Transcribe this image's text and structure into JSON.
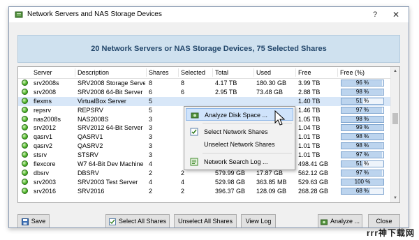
{
  "window": {
    "title": "Network Servers and NAS Storage Devices",
    "help": "?",
    "close": "✕"
  },
  "banner": {
    "text": "20 Network Servers or NAS Storage Devices, 75 Selected Shares"
  },
  "table": {
    "columns": [
      "Server",
      "Description",
      "Shares",
      "Selected",
      "Total",
      "Used",
      "Free",
      "Free (%)"
    ],
    "rows": [
      {
        "server": "srv2008s",
        "description": "SRV2008 Storage Server",
        "shares": "8",
        "selected": "8",
        "total": "4.17 TB",
        "used": "180.30 GB",
        "free": "3.99 TB",
        "free_pct": "96 %",
        "pct": 96
      },
      {
        "server": "srv2008",
        "description": "SRV2008 64-Bit Server",
        "shares": "6",
        "selected": "6",
        "total": "2.95 TB",
        "used": "73.48 GB",
        "free": "2.88 TB",
        "free_pct": "98 %",
        "pct": 98
      },
      {
        "server": "flexms",
        "description": "VirtualBox Server",
        "shares": "5",
        "selected": "",
        "total": "",
        "used": "",
        "free": "1.40 TB",
        "free_pct": "51 %",
        "pct": 51
      },
      {
        "server": "repsrv",
        "description": "REPSRV",
        "shares": "5",
        "selected": "",
        "total": "",
        "used": "",
        "free": "1.46 TB",
        "free_pct": "97 %",
        "pct": 97
      },
      {
        "server": "nas2008s",
        "description": "NAS2008S",
        "shares": "3",
        "selected": "",
        "total": "",
        "used": "",
        "free": "1.05 TB",
        "free_pct": "98 %",
        "pct": 98
      },
      {
        "server": "srv2012",
        "description": "SRV2012 64-Bit Server",
        "shares": "3",
        "selected": "",
        "total": "",
        "used": "",
        "free": "1.04 TB",
        "free_pct": "99 %",
        "pct": 99
      },
      {
        "server": "qasrv1",
        "description": "QASRV1",
        "shares": "3",
        "selected": "",
        "total": "",
        "used": "",
        "free": "1.01 TB",
        "free_pct": "98 %",
        "pct": 98
      },
      {
        "server": "qasrv2",
        "description": "QASRV2",
        "shares": "3",
        "selected": "",
        "total": "",
        "used": "",
        "free": "1.01 TB",
        "free_pct": "98 %",
        "pct": 98
      },
      {
        "server": "stsrv",
        "description": "STSRV",
        "shares": "3",
        "selected": "",
        "total": "",
        "used": "",
        "free": "1.01 TB",
        "free_pct": "97 %",
        "pct": 97
      },
      {
        "server": "flexcore",
        "description": "W7 64-Bit Dev Machine",
        "shares": "4",
        "selected": "",
        "total": "",
        "used": "",
        "free": "498.41 GB",
        "free_pct": "51 %",
        "pct": 51
      },
      {
        "server": "dbsrv",
        "description": "DBSRV",
        "shares": "2",
        "selected": "2",
        "total": "579.99 GB",
        "used": "17.87 GB",
        "free": "562.12 GB",
        "free_pct": "97 %",
        "pct": 97
      },
      {
        "server": "srv2003",
        "description": "SRV2003 Test Server",
        "shares": "4",
        "selected": "4",
        "total": "529.98 GB",
        "used": "363.85 MB",
        "free": "529.63 GB",
        "free_pct": "100 %",
        "pct": 100
      },
      {
        "server": "srv2016",
        "description": "SRV2016",
        "shares": "2",
        "selected": "2",
        "total": "396.37 GB",
        "used": "128.09 GB",
        "free": "268.28 GB",
        "free_pct": "68 %",
        "pct": 68
      }
    ]
  },
  "context_menu": {
    "items": [
      {
        "label": "Analyze Disk Space ...",
        "icon": "analyze-icon"
      },
      {
        "label": "Select Network Shares",
        "icon": "select-icon"
      },
      {
        "label": "Unselect Network Shares",
        "icon": ""
      },
      {
        "label": "Network Search Log ...",
        "icon": "log-icon"
      }
    ]
  },
  "buttons": {
    "save": "Save",
    "select_all": "Select All Shares",
    "unselect_all": "Unselect All Shares",
    "view_log": "View Log",
    "analyze": "Analyze ...",
    "close": "Close"
  },
  "watermark": "rrr神下载网",
  "colors": {
    "accent": "#cfe1ef",
    "banner_text": "#23476b",
    "bar_fill": "#bcd4ee",
    "status_green": "#52b82c"
  }
}
